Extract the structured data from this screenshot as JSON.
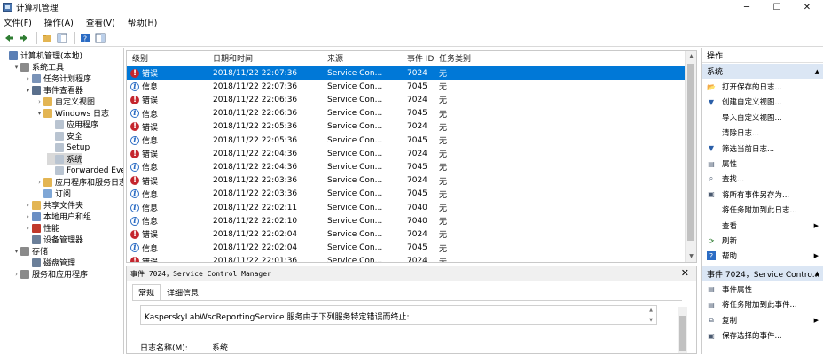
{
  "window": {
    "title": "计算机管理",
    "minimize": "─",
    "maximize": "☐",
    "close": "✕"
  },
  "menu": [
    "文件(F)",
    "操作(A)",
    "查看(V)",
    "帮助(H)"
  ],
  "toolbar": {
    "icons": [
      "back-icon",
      "forward-icon",
      "folder-up-icon",
      "console-tree-icon",
      "help-icon",
      "properties-icon"
    ]
  },
  "tree": [
    {
      "label": "计算机管理(本地)",
      "depth": 0,
      "exp": "",
      "icon": "computer-icon",
      "color": "#5b7fb5"
    },
    {
      "label": "系统工具",
      "depth": 1,
      "exp": "▾",
      "icon": "tools-icon",
      "color": "#8a8a8a"
    },
    {
      "label": "任务计划程序",
      "depth": 2,
      "exp": "›",
      "icon": "clock-icon",
      "color": "#7a93b8"
    },
    {
      "label": "事件查看器",
      "depth": 2,
      "exp": "▾",
      "icon": "event-viewer-icon",
      "color": "#5a6f8c"
    },
    {
      "label": "自定义视图",
      "depth": 3,
      "exp": "›",
      "icon": "folder-icon",
      "color": "#e3b553"
    },
    {
      "label": "Windows 日志",
      "depth": 3,
      "exp": "▾",
      "icon": "folder-icon",
      "color": "#e3b553"
    },
    {
      "label": "应用程序",
      "depth": 4,
      "exp": "",
      "icon": "log-icon",
      "color": "#b9c4d1"
    },
    {
      "label": "安全",
      "depth": 4,
      "exp": "",
      "icon": "log-icon",
      "color": "#b9c4d1"
    },
    {
      "label": "Setup",
      "depth": 4,
      "exp": "",
      "icon": "log-icon",
      "color": "#b9c4d1"
    },
    {
      "label": "系统",
      "depth": 4,
      "exp": "",
      "icon": "log-icon",
      "color": "#b9c4d1",
      "selected": true
    },
    {
      "label": "Forwarded Even",
      "depth": 4,
      "exp": "",
      "icon": "log-icon",
      "color": "#b9c4d1"
    },
    {
      "label": "应用程序和服务日志",
      "depth": 3,
      "exp": "›",
      "icon": "folder-icon",
      "color": "#e3b553"
    },
    {
      "label": "订阅",
      "depth": 3,
      "exp": "",
      "icon": "subscription-icon",
      "color": "#7fa7d6"
    },
    {
      "label": "共享文件夹",
      "depth": 2,
      "exp": "›",
      "icon": "shared-folder-icon",
      "color": "#e3b553"
    },
    {
      "label": "本地用户和组",
      "depth": 2,
      "exp": "›",
      "icon": "users-icon",
      "color": "#6b8fc4"
    },
    {
      "label": "性能",
      "depth": 2,
      "exp": "›",
      "icon": "performance-icon",
      "color": "#c0392b"
    },
    {
      "label": "设备管理器",
      "depth": 2,
      "exp": "",
      "icon": "device-manager-icon",
      "color": "#6b7f99"
    },
    {
      "label": "存储",
      "depth": 1,
      "exp": "▾",
      "icon": "storage-icon",
      "color": "#8a8a8a"
    },
    {
      "label": "磁盘管理",
      "depth": 2,
      "exp": "",
      "icon": "disk-icon",
      "color": "#6b7f99"
    },
    {
      "label": "服务和应用程序",
      "depth": 1,
      "exp": "›",
      "icon": "services-icon",
      "color": "#8a8a8a"
    }
  ],
  "columns": [
    "级别",
    "日期和时间",
    "来源",
    "事件 ID",
    "任务类别"
  ],
  "events": [
    {
      "level": "错误",
      "type": "error",
      "datetime": "2018/11/22 22:07:36",
      "source": "Service Con...",
      "id": "7024",
      "task": "无",
      "selected": true
    },
    {
      "level": "信息",
      "type": "info",
      "datetime": "2018/11/22 22:07:36",
      "source": "Service Con...",
      "id": "7045",
      "task": "无"
    },
    {
      "level": "错误",
      "type": "error",
      "datetime": "2018/11/22 22:06:36",
      "source": "Service Con...",
      "id": "7024",
      "task": "无"
    },
    {
      "level": "信息",
      "type": "info",
      "datetime": "2018/11/22 22:06:36",
      "source": "Service Con...",
      "id": "7045",
      "task": "无"
    },
    {
      "level": "错误",
      "type": "error",
      "datetime": "2018/11/22 22:05:36",
      "source": "Service Con...",
      "id": "7024",
      "task": "无"
    },
    {
      "level": "信息",
      "type": "info",
      "datetime": "2018/11/22 22:05:36",
      "source": "Service Con...",
      "id": "7045",
      "task": "无"
    },
    {
      "level": "错误",
      "type": "error",
      "datetime": "2018/11/22 22:04:36",
      "source": "Service Con...",
      "id": "7024",
      "task": "无"
    },
    {
      "level": "信息",
      "type": "info",
      "datetime": "2018/11/22 22:04:36",
      "source": "Service Con...",
      "id": "7045",
      "task": "无"
    },
    {
      "level": "错误",
      "type": "error",
      "datetime": "2018/11/22 22:03:36",
      "source": "Service Con...",
      "id": "7024",
      "task": "无"
    },
    {
      "level": "信息",
      "type": "info",
      "datetime": "2018/11/22 22:03:36",
      "source": "Service Con...",
      "id": "7045",
      "task": "无"
    },
    {
      "level": "信息",
      "type": "info",
      "datetime": "2018/11/22 22:02:11",
      "source": "Service Con...",
      "id": "7040",
      "task": "无"
    },
    {
      "level": "信息",
      "type": "info",
      "datetime": "2018/11/22 22:02:10",
      "source": "Service Con...",
      "id": "7040",
      "task": "无"
    },
    {
      "level": "错误",
      "type": "error",
      "datetime": "2018/11/22 22:02:04",
      "source": "Service Con...",
      "id": "7024",
      "task": "无"
    },
    {
      "level": "信息",
      "type": "info",
      "datetime": "2018/11/22 22:02:04",
      "source": "Service Con...",
      "id": "7045",
      "task": "无"
    },
    {
      "level": "错误",
      "type": "error",
      "datetime": "2018/11/22 22:01:36",
      "source": "Service Con...",
      "id": "7024",
      "task": "无"
    }
  ],
  "detail": {
    "header": "事件 7024，Service Control Manager",
    "close": "✕",
    "tabs": [
      "常规",
      "详细信息"
    ],
    "message": "KasperskyLabWscReportingService 服务由于下列服务特定错误而终止:",
    "log_name_label": "日志名称(M):",
    "log_name_value": "系统"
  },
  "actions": {
    "header": "操作",
    "sections": [
      {
        "title": "系统",
        "items": [
          {
            "label": "打开保存的日志...",
            "icon": "open-folder-icon",
            "glyph": "📂",
            "sub": false
          },
          {
            "label": "创建自定义视图...",
            "icon": "filter-icon",
            "glyph": "▼",
            "sub": false
          },
          {
            "label": "导入自定义视图...",
            "icon": "import-icon",
            "glyph": "",
            "sub": false
          },
          {
            "label": "清除日志...",
            "icon": "clear-log-icon",
            "glyph": "",
            "sub": false
          },
          {
            "label": "筛选当前日志...",
            "icon": "filter-icon",
            "glyph": "▼",
            "sub": false
          },
          {
            "label": "属性",
            "icon": "properties-icon",
            "glyph": "▤",
            "sub": false
          },
          {
            "label": "查找...",
            "icon": "find-icon",
            "glyph": "⌕",
            "sub": false
          },
          {
            "label": "将所有事件另存为...",
            "icon": "save-icon",
            "glyph": "▣",
            "sub": false
          },
          {
            "label": "将任务附加到此日志...",
            "icon": "attach-task-icon",
            "glyph": "",
            "sub": false
          },
          {
            "label": "查看",
            "icon": "view-icon",
            "glyph": "",
            "sub": true
          },
          {
            "label": "刷新",
            "icon": "refresh-icon",
            "glyph": "⟳",
            "sub": false
          },
          {
            "label": "帮助",
            "icon": "help-icon",
            "glyph": "?",
            "sub": true
          }
        ]
      },
      {
        "title": "事件 7024，Service Contro...",
        "items": [
          {
            "label": "事件属性",
            "icon": "event-properties-icon",
            "glyph": "▤",
            "sub": false
          },
          {
            "label": "将任务附加到此事件...",
            "icon": "attach-task-icon",
            "glyph": "▤",
            "sub": false
          },
          {
            "label": "复制",
            "icon": "copy-icon",
            "glyph": "⧉",
            "sub": true
          },
          {
            "label": "保存选择的事件...",
            "icon": "save-icon",
            "glyph": "▣",
            "sub": false
          }
        ]
      }
    ]
  },
  "colors": {
    "selection": "#0078d7",
    "error": "#c4262e",
    "info": "#2b6cc4",
    "section_bg": "#dbe6f4"
  }
}
